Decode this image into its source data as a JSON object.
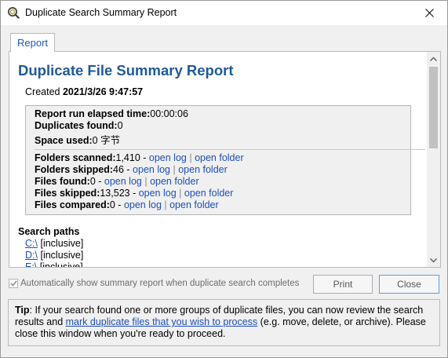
{
  "window": {
    "title": "Duplicate Search Summary Report"
  },
  "tabs": [
    {
      "label": "Report"
    }
  ],
  "report": {
    "title": "Duplicate File Summary Report",
    "created_label": "Created",
    "created_value": "2021/3/26 9:47:57",
    "elapsed_label": "Report run elapsed time:",
    "elapsed_value": "00:00:06",
    "duplicates_label": "Duplicates found:",
    "duplicates_value": "0",
    "space_label": "Space used:",
    "space_value": "0 字节",
    "stats": [
      {
        "label": "Folders scanned:",
        "value": "1,410",
        "dash": " - ",
        "log": "open log",
        "sep": " | ",
        "folder": "open folder"
      },
      {
        "label": "Folders skipped:",
        "value": "46",
        "dash": " - ",
        "log": "open log",
        "sep": " | ",
        "folder": "open folder"
      },
      {
        "label": "Files found:",
        "value": "0",
        "dash": " - ",
        "log": "open log",
        "sep": " | ",
        "folder": "open folder"
      },
      {
        "label": "Files skipped:",
        "value": "13,523",
        "dash": " - ",
        "log": "open log",
        "sep": " | ",
        "folder": "open folder"
      },
      {
        "label": "Files compared:",
        "value": "0",
        "dash": " - ",
        "log": "open log",
        "sep": " | ",
        "folder": "open folder"
      }
    ],
    "search_paths_heading": "Search paths",
    "search_paths": [
      {
        "path": "C:\\",
        "tag": "[inclusive]"
      },
      {
        "path": "D:\\",
        "tag": "[inclusive]"
      },
      {
        "path": "E:\\",
        "tag": "[inclusive]"
      }
    ]
  },
  "options": {
    "auto_show_label": "Automatically show summary report when duplicate search completes",
    "auto_show_checked": true
  },
  "buttons": {
    "print": "Print",
    "close": "Close"
  },
  "tip": {
    "label": "Tip",
    "text_before": ": If your search found one or more groups of duplicate files, you can now review the search results and ",
    "link": "mark duplicate files that you wish to process",
    "text_after": " (e.g. move, delete, or archive). Please close this window when you're ready to proceed."
  },
  "icons": {
    "app": "magnifier-q-icon",
    "close": "close-icon",
    "scroll_up": "chevron-up-icon",
    "scroll_down": "chevron-down-icon",
    "checkbox": "checkmark-icon"
  },
  "colors": {
    "title_blue": "#1f5a96",
    "link_blue": "#1f4fb5",
    "tab_blue": "#1a5fa8",
    "focus_border": "#5aa0e0"
  }
}
